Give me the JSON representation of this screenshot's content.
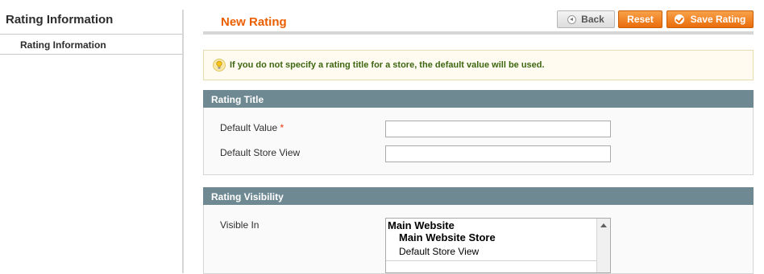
{
  "sidebar": {
    "title": "Rating Information",
    "items": [
      {
        "label": "Rating Information",
        "active": true
      }
    ]
  },
  "header": {
    "title": "New Rating",
    "buttons": {
      "back": "Back",
      "reset": "Reset",
      "save": "Save Rating"
    }
  },
  "notice": {
    "text": "If you do not specify a rating title for a store, the default value will be used.",
    "icon": "lightbulb-icon"
  },
  "rating_title": {
    "heading": "Rating Title",
    "fields": [
      {
        "label": "Default Value",
        "required_mark": "*",
        "value": ""
      },
      {
        "label": "Default Store View",
        "value": ""
      }
    ]
  },
  "rating_visibility": {
    "heading": "Rating Visibility",
    "label": "Visible In",
    "options": {
      "website": "Main Website",
      "store": "Main Website Store",
      "view": "Default Store View"
    }
  },
  "colors": {
    "accent": "#eb5e00",
    "section_header": "#6f8992",
    "notice_text": "#3d6611",
    "button_orange": "#ea6c0b"
  }
}
